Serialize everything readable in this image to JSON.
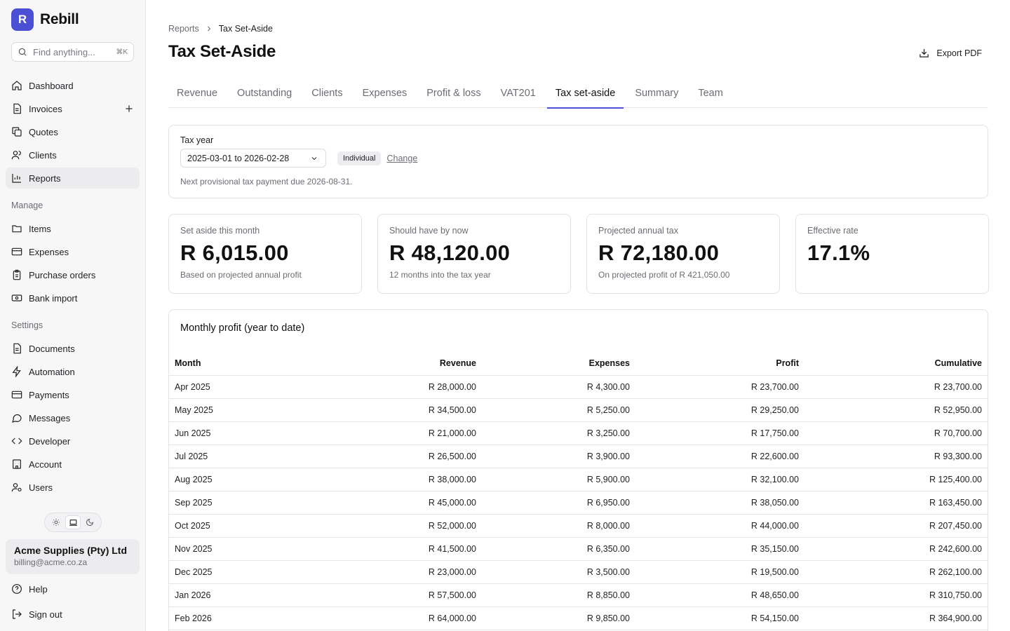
{
  "app": {
    "logo_letter": "R",
    "name": "Rebill"
  },
  "search": {
    "placeholder": "Find anything...",
    "shortcut": "⌘K"
  },
  "nav": {
    "dashboard": "Dashboard",
    "invoices": "Invoices",
    "quotes": "Quotes",
    "clients": "Clients",
    "reports": "Reports"
  },
  "manage": {
    "label": "Manage",
    "items": "Items",
    "expenses": "Expenses",
    "purchase_orders": "Purchase orders",
    "bank_import": "Bank import"
  },
  "settings": {
    "label": "Settings",
    "documents": "Documents",
    "automation": "Automation",
    "payments": "Payments",
    "messages": "Messages",
    "developer": "Developer",
    "account": "Account",
    "users": "Users"
  },
  "account": {
    "name": "Acme Supplies (Pty) Ltd",
    "email": "billing@acme.co.za"
  },
  "footer": {
    "help": "Help",
    "sign_out": "Sign out"
  },
  "breadcrumb": {
    "parent": "Reports",
    "current": "Tax Set-Aside"
  },
  "page": {
    "title": "Tax Set-Aside",
    "export_label": "Export PDF"
  },
  "tabs": [
    "Revenue",
    "Outstanding",
    "Clients",
    "Expenses",
    "Profit & loss",
    "VAT201",
    "Tax set-aside",
    "Summary",
    "Team"
  ],
  "active_tab": "Tax set-aside",
  "filter": {
    "label": "Tax year",
    "selected": "2025-03-01 to 2026-02-28",
    "badge": "Individual",
    "change": "Change",
    "note": "Next provisional tax payment due 2026-08-31."
  },
  "stats": {
    "set_aside": {
      "label": "Set aside this month",
      "value": "R 6,015.00",
      "sub": "Based on projected annual profit"
    },
    "should_have": {
      "label": "Should have by now",
      "value": "R 48,120.00",
      "sub": "12 months into the tax year"
    },
    "projected": {
      "label": "Projected annual tax",
      "value": "R 72,180.00",
      "sub": "On projected profit of R 421,050.00"
    },
    "rate": {
      "label": "Effective rate",
      "value": "17.1%"
    }
  },
  "table": {
    "title": "Monthly profit (year to date)",
    "headers": {
      "month": "Month",
      "revenue": "Revenue",
      "expenses": "Expenses",
      "profit": "Profit",
      "cumulative": "Cumulative"
    },
    "rows": [
      {
        "month": "Apr 2025",
        "revenue": "R 28,000.00",
        "expenses": "R 4,300.00",
        "profit": "R 23,700.00",
        "cumulative": "R 23,700.00"
      },
      {
        "month": "May 2025",
        "revenue": "R 34,500.00",
        "expenses": "R 5,250.00",
        "profit": "R 29,250.00",
        "cumulative": "R 52,950.00"
      },
      {
        "month": "Jun 2025",
        "revenue": "R 21,000.00",
        "expenses": "R 3,250.00",
        "profit": "R 17,750.00",
        "cumulative": "R 70,700.00"
      },
      {
        "month": "Jul 2025",
        "revenue": "R 26,500.00",
        "expenses": "R 3,900.00",
        "profit": "R 22,600.00",
        "cumulative": "R 93,300.00"
      },
      {
        "month": "Aug 2025",
        "revenue": "R 38,000.00",
        "expenses": "R 5,900.00",
        "profit": "R 32,100.00",
        "cumulative": "R 125,400.00"
      },
      {
        "month": "Sep 2025",
        "revenue": "R 45,000.00",
        "expenses": "R 6,950.00",
        "profit": "R 38,050.00",
        "cumulative": "R 163,450.00"
      },
      {
        "month": "Oct 2025",
        "revenue": "R 52,000.00",
        "expenses": "R 8,000.00",
        "profit": "R 44,000.00",
        "cumulative": "R 207,450.00"
      },
      {
        "month": "Nov 2025",
        "revenue": "R 41,500.00",
        "expenses": "R 6,350.00",
        "profit": "R 35,150.00",
        "cumulative": "R 242,600.00"
      },
      {
        "month": "Dec 2025",
        "revenue": "R 23,000.00",
        "expenses": "R 3,500.00",
        "profit": "R 19,500.00",
        "cumulative": "R 262,100.00"
      },
      {
        "month": "Jan 2026",
        "revenue": "R 57,500.00",
        "expenses": "R 8,850.00",
        "profit": "R 48,650.00",
        "cumulative": "R 310,750.00"
      },
      {
        "month": "Feb 2026",
        "revenue": "R 64,000.00",
        "expenses": "R 9,850.00",
        "profit": "R 54,150.00",
        "cumulative": "R 364,900.00"
      }
    ]
  },
  "colors": {
    "accent": "#4a4fd6",
    "sidebar_bg": "#f7f7f8",
    "muted_text": "#6c6c74"
  }
}
